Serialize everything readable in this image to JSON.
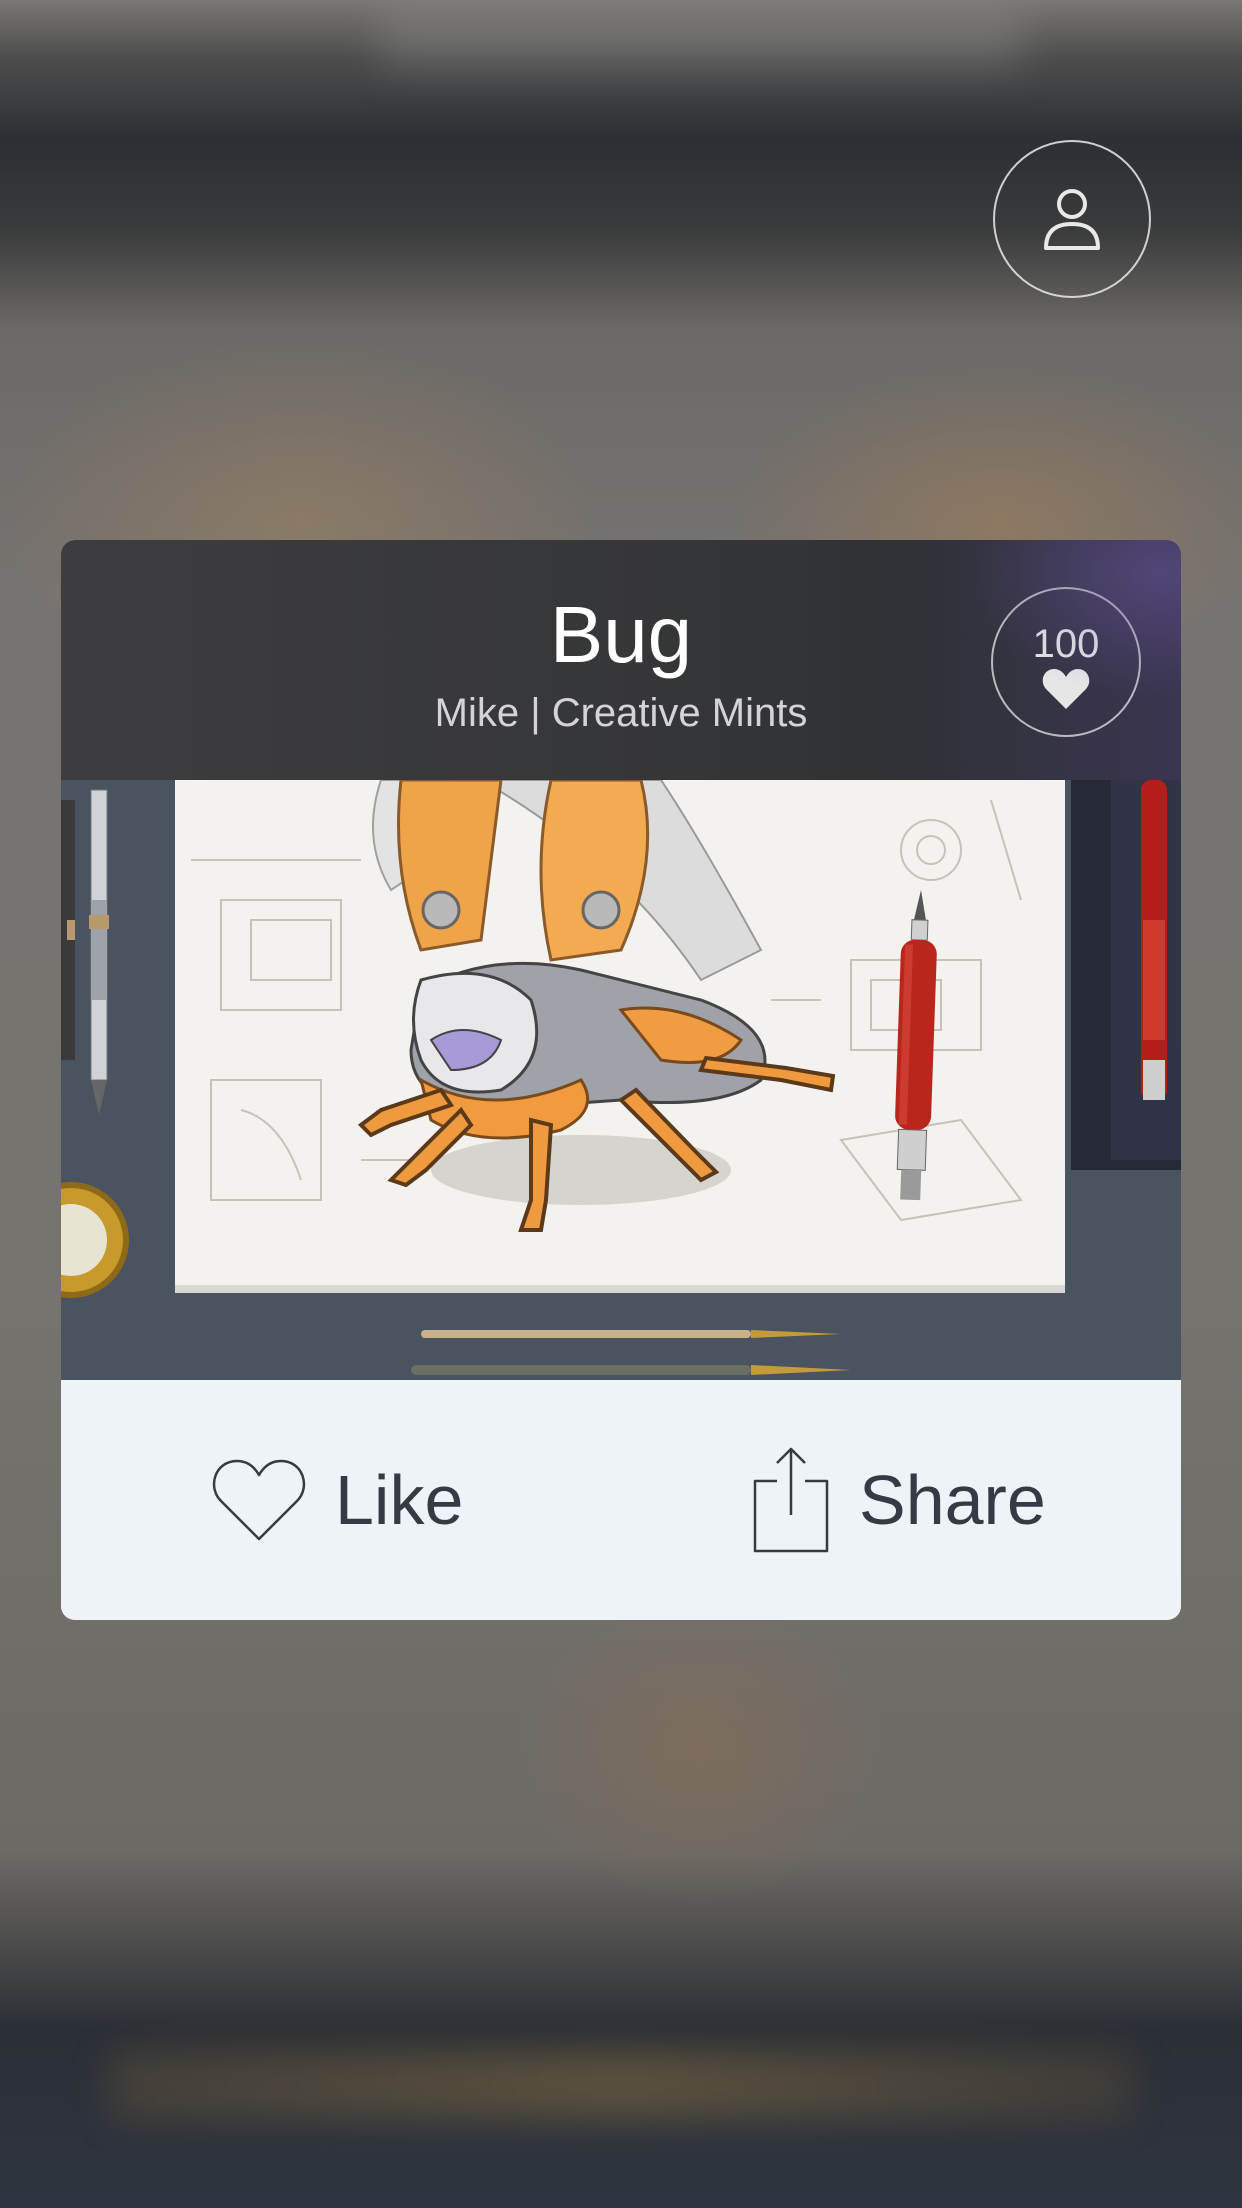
{
  "post": {
    "title": "Bug",
    "author": "Mike | Creative Mints",
    "likes_count": "100"
  },
  "actions": {
    "like_label": "Like",
    "share_label": "Share"
  },
  "icons": {
    "profile": "user-icon",
    "badge_heart": "heart-filled-icon",
    "like": "heart-outline-icon",
    "share": "share-icon"
  },
  "colors": {
    "header_bg": "#3d3d3f",
    "action_bar_bg": "#eef3f8",
    "action_text": "#353a45"
  }
}
